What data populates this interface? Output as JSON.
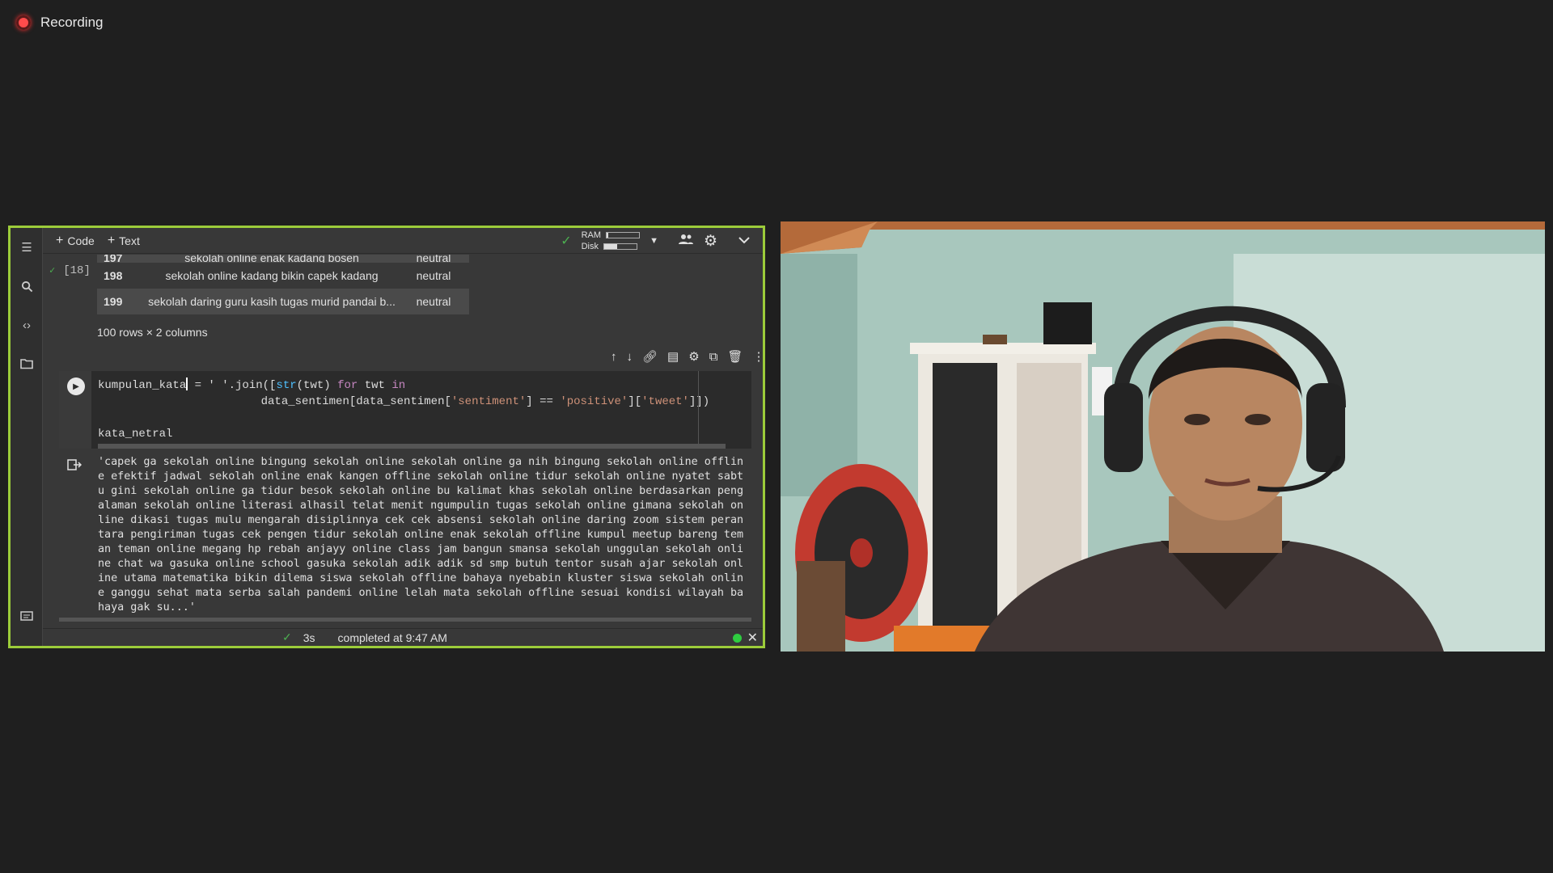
{
  "recording": {
    "label": "Recording"
  },
  "colab": {
    "toolbar": {
      "add_code": "Code",
      "add_text": "Text",
      "ram_label": "RAM",
      "disk_label": "Disk",
      "ram_fraction": 0.05,
      "disk_fraction": 0.4
    },
    "exec_count": "[18]",
    "dataframe": {
      "partial_row": {
        "index": "197",
        "text": "sekolah online enak kadang bosen",
        "label": "neutral"
      },
      "rows": [
        {
          "index": "198",
          "text": "sekolah online kadang bikin capek kadang",
          "label": "neutral"
        },
        {
          "index": "199",
          "text": "sekolah daring guru kasih tugas murid pandai b...",
          "label": "neutral"
        }
      ],
      "summary": "100 rows × 2 columns"
    },
    "code": {
      "var": "kumpulan_kata",
      "line1_rest": " = ' '.join([",
      "fn_str": "str",
      "line1_mid": "(twt) ",
      "kw_for": "for",
      "line1_mid2": " twt ",
      "kw_in": "in",
      "line2_a": "                        data_sentimen[data_sentimen[",
      "str_sentiment": "'sentiment'",
      "line2_b": "] == ",
      "str_positive": "'positive'",
      "line2_c": "][",
      "str_tweet": "'tweet'",
      "line2_d": "]])",
      "line3": "kata_netral"
    },
    "output_text": "'capek ga sekolah online bingung sekolah online sekolah online ga nih bingung sekolah online offline efektif jadwal sekolah online enak kangen offline sekolah online tidur sekolah online nyatet sabtu gini sekolah online ga tidur besok sekolah online bu kalimat khas sekolah online berdasarkan pengalaman sekolah online literasi alhasil telat menit ngumpulin tugas sekolah online gimana sekolah online dikasi tugas mulu mengarah disiplinnya cek cek absensi sekolah online daring zoom sistem perantara pengiriman tugas cek pengen tidur sekolah online enak sekolah offline kumpul meetup bareng teman teman online megang hp rebah anjayy online class jam bangun smansa sekolah unggulan sekolah online chat wa gasuka online school gasuka sekolah adik adik sd smp butuh tentor susah ajar sekolah online utama matematika bikin dilema siswa sekolah offline bahaya nyebabin kluster siswa sekolah online ganggu sehat mata serba salah pandemi online lelah mata sekolah offline sesuai kondisi wilayah bahaya gak su...'",
    "status": {
      "time": "3s",
      "message": "completed at 9:47 AM"
    }
  },
  "icons": {
    "rail": [
      "toc-icon",
      "search-icon",
      "code-snippets-icon",
      "folder-icon",
      "terminal-icon"
    ],
    "cell_toolbar": [
      "arrow-up-icon",
      "arrow-down-icon",
      "link-icon",
      "comment-icon",
      "settings-icon",
      "mirror-icon",
      "delete-icon",
      "more-icon"
    ]
  }
}
